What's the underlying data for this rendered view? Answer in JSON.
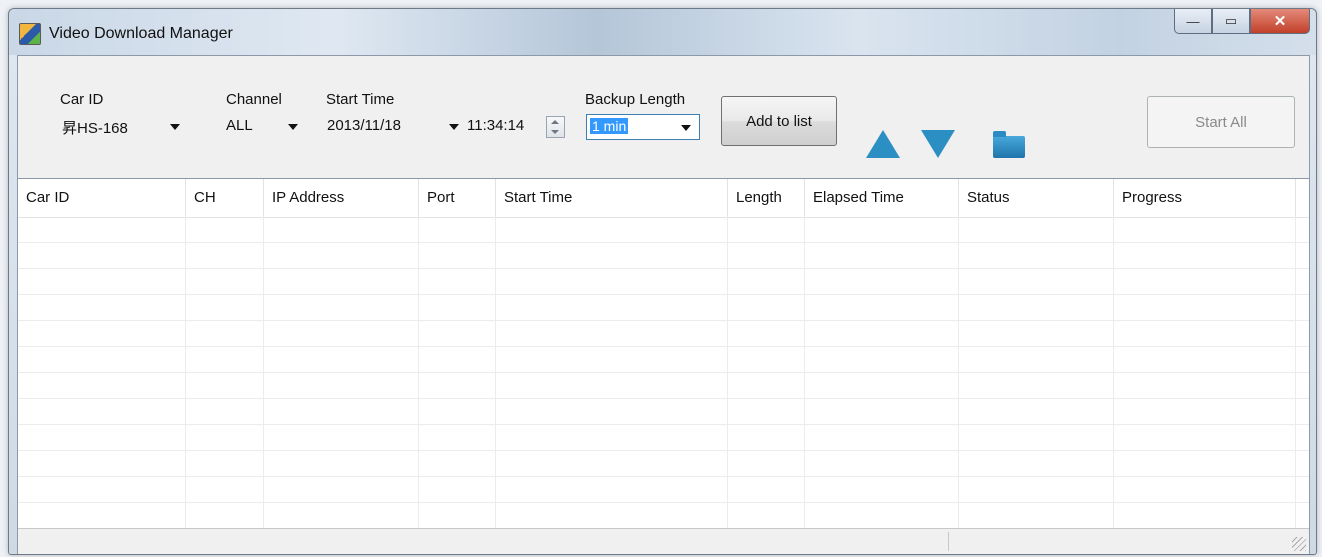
{
  "window": {
    "title": "Video Download Manager",
    "controls": {
      "minimize": "—",
      "maximize": "▭",
      "close": "✕"
    }
  },
  "toolbar": {
    "car_id_label": "Car ID",
    "car_id_value": "昇HS-168",
    "channel_label": "Channel",
    "channel_value": "ALL",
    "start_time_label": "Start Time",
    "start_date_value": "2013/11/18",
    "start_time_value": "11:34:14",
    "backup_length_label": "Backup Length",
    "backup_length_value": "1 min",
    "add_to_list_label": "Add to list",
    "start_all_label": "Start All"
  },
  "grid": {
    "columns": [
      "Car ID",
      "CH",
      "IP Address",
      "Port",
      "Start Time",
      "Length",
      "Elapsed Time",
      "Status",
      "Progress"
    ]
  },
  "icons": {
    "move_up": "triangle-up-icon",
    "move_down": "triangle-down-icon",
    "folder": "folder-icon"
  },
  "colors": {
    "accent": "#2c8fc4",
    "selection": "#3399ff"
  }
}
